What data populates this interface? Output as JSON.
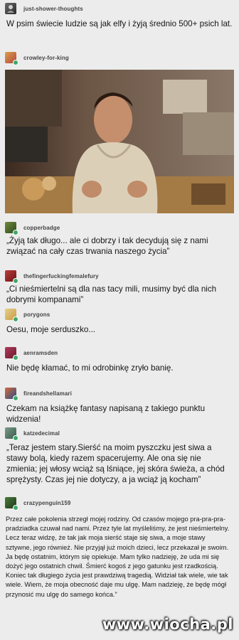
{
  "posts": [
    {
      "user": "just-shower-thoughts",
      "text": "W psim świecie ludzie są jak elfy i żyją średnio 500+ psich lat."
    },
    {
      "user": "crowley-for-king",
      "text": ""
    },
    {
      "user": "copperbadge",
      "text": "„Żyją tak długo... ale ci dobrzy i tak decydują się z nami związać na cały czas trwania naszego życia”"
    },
    {
      "user": "thefingerfuckingfemalefury",
      "text": "„Ci nieśmiertelni są dla nas tacy mili, musimy być dla nich dobrymi kompanami”"
    },
    {
      "user": "porygons",
      "text": "Oesu, moje serduszko..."
    },
    {
      "user": "aenramsden",
      "text": "Nie będę kłamać, to mi odrobinkę zryło banię."
    },
    {
      "user": "fireandshellamari",
      "text": "Czekam na książkę fantasy napisaną z takiego punktu widzenia!"
    },
    {
      "user": "katzedecimal",
      "text": "„Teraz jestem stary.Sierść na moim pyszczku jest siwa a stawy bolą, kiedy razem spacerujemy. Ale ona się nie zmienia; jej włosy wciąż są lśniące, jej skóra świeża, a chód sprężysty. Czas jej nie dotyczy, a ja wciąż ją kocham”"
    },
    {
      "user": "crazypenguin159",
      "text": "Przez całe pokolenia strzegł mojej rodziny. Od czasów mojego pra-pra-pra-pradziadka czuwał nad nami. Przez tyle lat myśleliśmy, że jest nieśmiertelny. Lecz teraz widzę, że tak jak moja sierść staje się siwa, a moje stawy sztywne, jego również. Nie przyjął już moich dzieci, lecz przekazał je swoim. Ja będę ostatnim, którym się opiekuje. Mam tylko nadzieję, że uda mi się dożyć jego ostatnich chwil. Śmierć kogoś z jego gatunku jest rzadkością. Koniec tak długiego życia jest prawdziwą tragedią. Widział tak wiele, wie tak wiele. Wiem, że moja obecność daje mu ulgę. Mam nadzieję, że będę mógł przynosić mu ulgę do samego końca.”"
    }
  ],
  "watermark": "www.wiocha.pl",
  "colors": {
    "background": "#ececec",
    "accent_badge": "#3ea86a"
  }
}
